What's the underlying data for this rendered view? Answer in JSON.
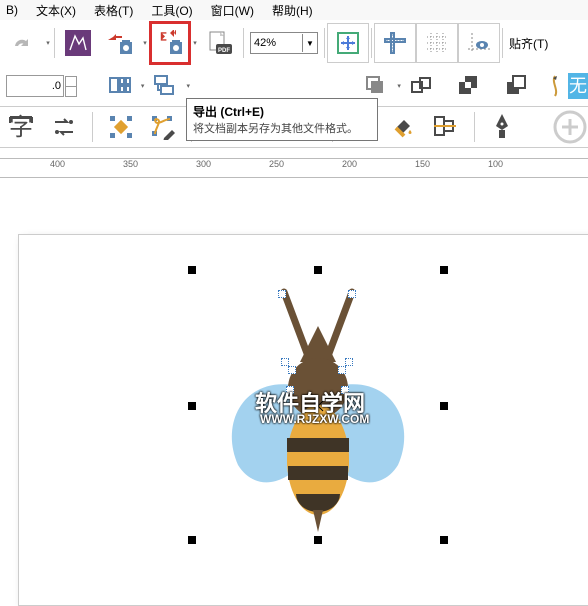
{
  "menu": {
    "b": "B)",
    "text": "文本(X)",
    "table": "表格(T)",
    "tools": "工具(O)",
    "window": "窗口(W)",
    "help": "帮助(H)"
  },
  "toolbar": {
    "zoom_value": "42%",
    "align": "贴齐(T)"
  },
  "tooltip": {
    "title": "导出 (Ctrl+E)",
    "desc": "将文档副本另存为其他文件格式。"
  },
  "props": {
    "value": ".0"
  },
  "ruler": {
    "t400": "400",
    "t350": "350",
    "t300": "300",
    "t250": "250",
    "t200": "200",
    "t150": "150",
    "t100": "100"
  },
  "watermark": {
    "line1": "软件自学网",
    "line2": "WWW.RJZXW.COM"
  }
}
